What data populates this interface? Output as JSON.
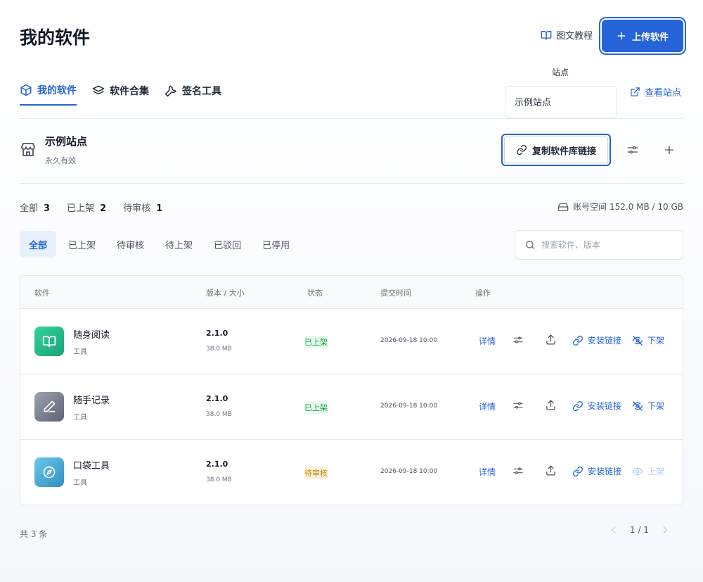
{
  "page": {
    "title": "我的软件"
  },
  "header": {
    "tutorial_label": "图文教程",
    "upload_label": "上传软件",
    "colors": {
      "accent": "#2563d9"
    }
  },
  "tabs": [
    {
      "label": "我的软件",
      "icon": "box-icon",
      "active": true
    },
    {
      "label": "软件合集",
      "icon": "layers-icon",
      "active": false
    },
    {
      "label": "签名工具",
      "icon": "wrench-icon",
      "active": false
    }
  ],
  "site_picker": {
    "label": "站点",
    "selected": "示例站点",
    "view_label": "查看站点"
  },
  "site": {
    "name": "示例站点",
    "validity": "永久有效",
    "copy_label": "复制软件库链接"
  },
  "stats": {
    "all_label": "全部",
    "all_count": "3",
    "listed_label": "已上架",
    "listed_count": "2",
    "pending_label": "待审核",
    "pending_count": "1",
    "storage": "账号空间 152.0 MB / 10 GB"
  },
  "filters": [
    "全部",
    "已上架",
    "待审核",
    "待上架",
    "已驳回",
    "已停用"
  ],
  "search": {
    "placeholder": "搜索软件、版本"
  },
  "table": {
    "headers": {
      "software": "软件",
      "version": "版本 / 大小",
      "status": "状态",
      "time": "提交时间",
      "actions": "操作"
    },
    "rows": [
      {
        "name": "随身阅读",
        "category": "工具",
        "version": "2.1.0",
        "size": "38.0 MB",
        "status": "已上架",
        "time": "2026-09-18 10:00",
        "detail": "详情",
        "link": "安装链接",
        "toggle": "下架",
        "icon": "book-icon"
      },
      {
        "name": "随手记录",
        "category": "工具",
        "version": "2.1.0",
        "size": "38.0 MB",
        "status": "已上架",
        "time": "2026-09-18 10:00",
        "detail": "详情",
        "link": "安装链接",
        "toggle": "下架",
        "icon": "pen-icon"
      },
      {
        "name": "口袋工具",
        "category": "工具",
        "version": "2.1.0",
        "size": "38.0 MB",
        "status": "待审核",
        "time": "2026-09-18 10:00",
        "detail": "详情",
        "link": "安装链接",
        "toggle": "上架",
        "icon": "compass-icon"
      }
    ]
  },
  "footer": {
    "total": "共 3 条",
    "page": "1 / 1"
  }
}
